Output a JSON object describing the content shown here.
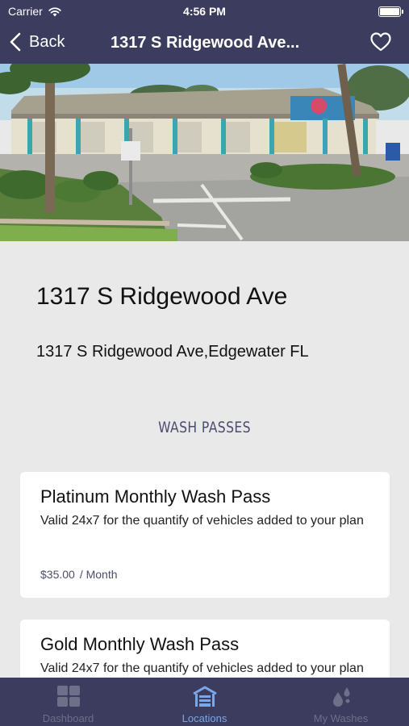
{
  "status_bar": {
    "carrier": "Carrier",
    "time": "4:56 PM"
  },
  "nav": {
    "back_label": "Back",
    "title": "1317 S Ridgewood Ave..."
  },
  "location": {
    "name": "1317 S Ridgewood Ave",
    "address": "1317 S Ridgewood Ave,Edgewater FL"
  },
  "section": {
    "wash_passes_label": "WASH PASSES"
  },
  "passes": [
    {
      "name": "Platinum Monthly Wash Pass",
      "description": "Valid 24x7 for the quantify of vehicles added to your plan",
      "price": "$35.00",
      "period": "/ Month"
    },
    {
      "name": "Gold Monthly Wash Pass",
      "description": "Valid 24x7 for the quantify of vehicles added to your plan"
    }
  ],
  "tabs": [
    {
      "label": "Dashboard",
      "icon": "dashboard-grid-icon"
    },
    {
      "label": "Locations",
      "icon": "car-wash-building-icon",
      "active": true
    },
    {
      "label": "My Washes",
      "icon": "water-drops-icon"
    }
  ],
  "colors": {
    "bar_background": "#3b3c5e",
    "page_background": "#e9e9ea",
    "active_tab": "#7ca6e6",
    "inactive_tab": "#6e6f88",
    "accent_text": "#4b4c6e"
  }
}
